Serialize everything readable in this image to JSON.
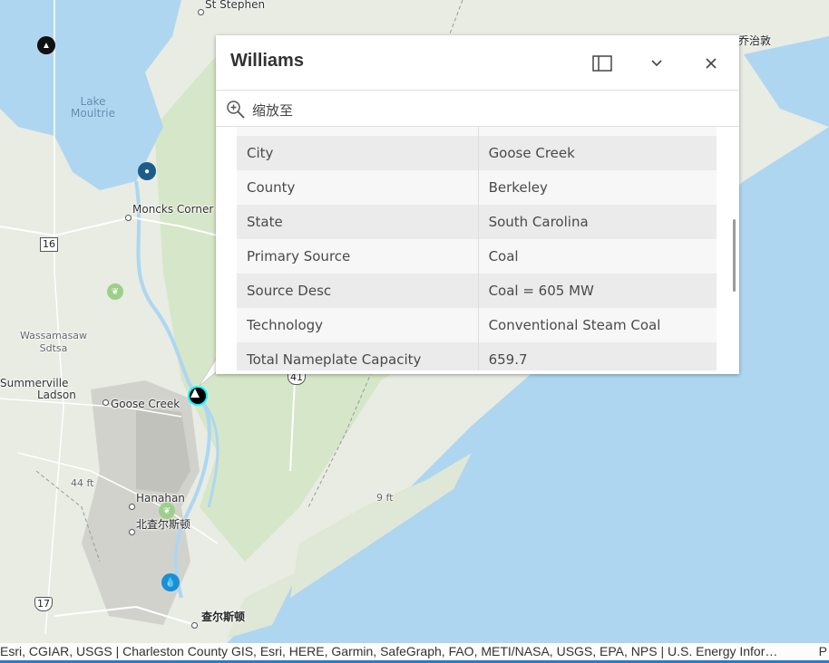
{
  "map": {
    "places": {
      "st_stephen": "St Stephen",
      "lake_moultrie": "Lake\nMoultrie",
      "moncks_corner": "Moncks Corner",
      "wassamasaw": "Wassamasaw\nSdtsa",
      "summerville": "Summerville",
      "ladson": "Ladson",
      "goose_creek": "Goose Creek",
      "hanahan": "Hanahan",
      "north_charleston": "北査尔斯顿",
      "charleston": "查尔斯顿",
      "qiaozhidun": "乔治敦",
      "elev_44": "44 ft",
      "elev_9": "9 ft"
    },
    "shields": {
      "r16": "16",
      "r41": "41",
      "r17": "17"
    },
    "colors": {
      "water": "#aed6f1",
      "land": "#e6ebe0",
      "urban": "#c8c8c4",
      "forest": "#cfe3c0",
      "highlight": "#00ffff"
    }
  },
  "popup": {
    "title": "Williams",
    "dock_icon": "dock-icon",
    "collapse_icon": "chevron-down-icon",
    "close_icon": "close-icon",
    "zoom_to": "缩放至",
    "rows": [
      {
        "label": "",
        "value": ""
      },
      {
        "label": "City",
        "value": "Goose Creek"
      },
      {
        "label": "County",
        "value": "Berkeley"
      },
      {
        "label": "State",
        "value": "South Carolina"
      },
      {
        "label": "Primary Source",
        "value": "Coal"
      },
      {
        "label": "Source Desc",
        "value": "Coal = 605 MW"
      },
      {
        "label": "Technology",
        "value": "Conventional Steam Coal"
      },
      {
        "label": "Total Nameplate Capacity",
        "value": "659.7"
      }
    ]
  },
  "attribution": {
    "text": "Esri, CGIAR, USGS | Charleston County GIS, Esri, HERE, Garmin, SafeGraph, FAO, METI/NASA, USGS, EPA, NPS | U.S. Energy Infor…",
    "right": "P"
  }
}
